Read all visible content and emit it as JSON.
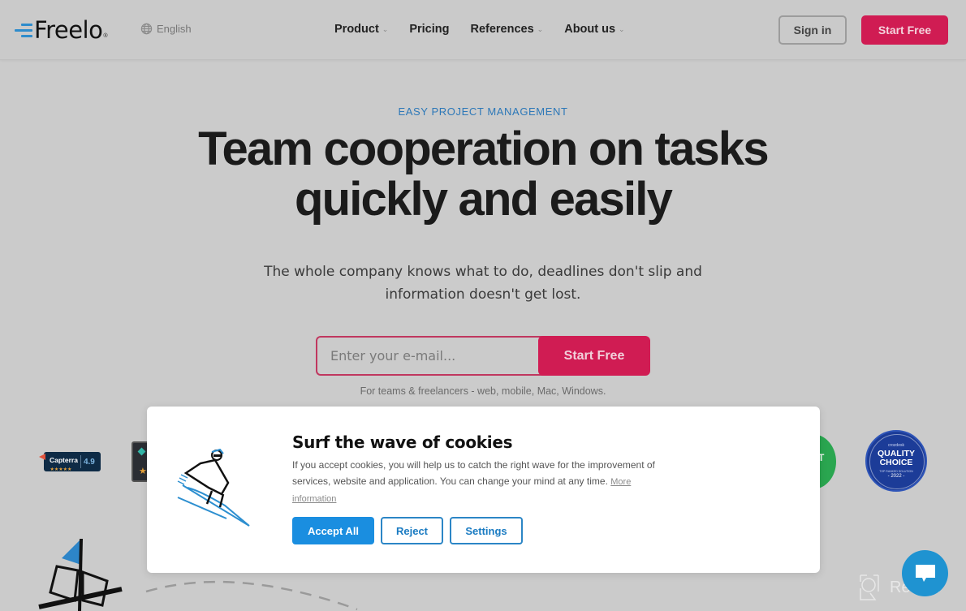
{
  "header": {
    "logo_text": "Freelo",
    "logo_mark": "®",
    "language": "English",
    "nav": [
      {
        "label": "Product",
        "has_dropdown": true
      },
      {
        "label": "Pricing",
        "has_dropdown": false
      },
      {
        "label": "References",
        "has_dropdown": true
      },
      {
        "label": "About us",
        "has_dropdown": true
      }
    ],
    "signin_label": "Sign in",
    "start_free_label": "Start Free"
  },
  "hero": {
    "eyebrow": "EASY PROJECT MANAGEMENT",
    "headline_line1": "Team cooperation on tasks",
    "headline_line2": "quickly and easily",
    "subtitle_line1": "The whole company knows what to do, deadlines don't slip and",
    "subtitle_line2": "information doesn't get lost.",
    "email_placeholder": "Enter your e-mail...",
    "email_value": "",
    "cta_label": "Start Free",
    "platforms_note": "For teams & freelancers - web, mobile, Mac, Windows."
  },
  "badges": {
    "capterra": {
      "name": "Capterra",
      "stars": "★★★★★",
      "score": "4.9"
    },
    "green_badge_text": "T",
    "quality": {
      "brand": "crozdesk",
      "title_line1": "QUALITY",
      "title_line2": "CHOICE",
      "sub": "TOP RANKED SOLUTION",
      "year": "- 2022 -"
    }
  },
  "cookie_dialog": {
    "title": "Surf the wave of cookies",
    "body": "If you accept cookies, you will help us to catch the right wave for the improvement of services, website and application. You can change your mind at any time.",
    "more_link": "More information",
    "accept_label": "Accept All",
    "reject_label": "Reject",
    "settings_label": "Settings"
  },
  "watermark": {
    "text": "Revain"
  },
  "colors": {
    "brand_pink": "#d01c53",
    "brand_blue": "#2e8ccc",
    "accept_blue": "#1a8ee0",
    "chat_blue": "#1f93d1"
  }
}
